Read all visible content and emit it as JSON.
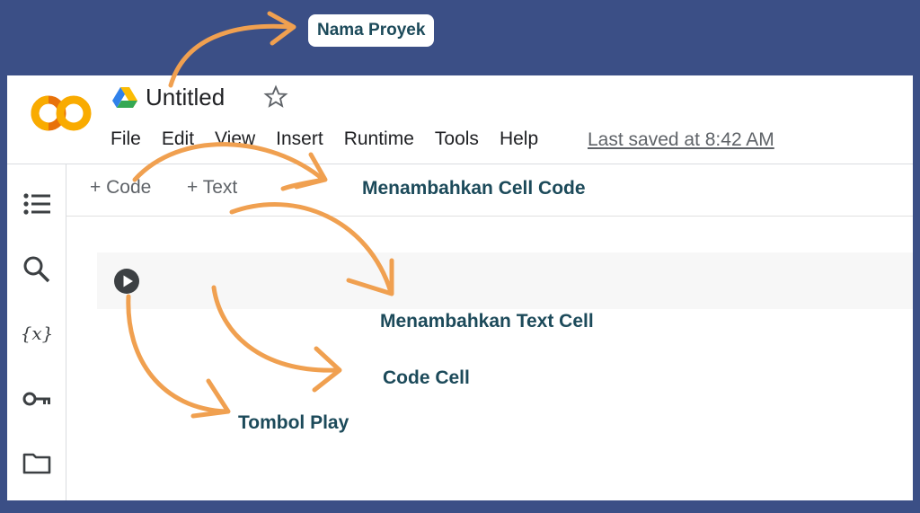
{
  "annotations": {
    "project_name": "Nama Proyek",
    "add_code_cell": "Menambahkan Cell Code",
    "add_text_cell": "Menambahkan Text Cell",
    "code_cell": "Code Cell",
    "play_button": "Tombol Play"
  },
  "header": {
    "logo_text": "CO",
    "title": "Untitled",
    "menu": [
      "File",
      "Edit",
      "View",
      "Insert",
      "Runtime",
      "Tools",
      "Help"
    ],
    "last_saved": "Last saved at 8:42 AM"
  },
  "toolbar": {
    "add_code_label": "+ Code",
    "add_text_label": "+ Text"
  },
  "sidebar": {
    "items": [
      "toc-icon",
      "search-icon",
      "variables-icon",
      "key-icon",
      "folder-icon"
    ]
  },
  "colors": {
    "background": "#3b4f86",
    "arrow": "#f0a050",
    "annotation_text": "#1c4a5a",
    "logo_orange": "#f9ab00",
    "logo_dark_orange": "#e8710a"
  }
}
